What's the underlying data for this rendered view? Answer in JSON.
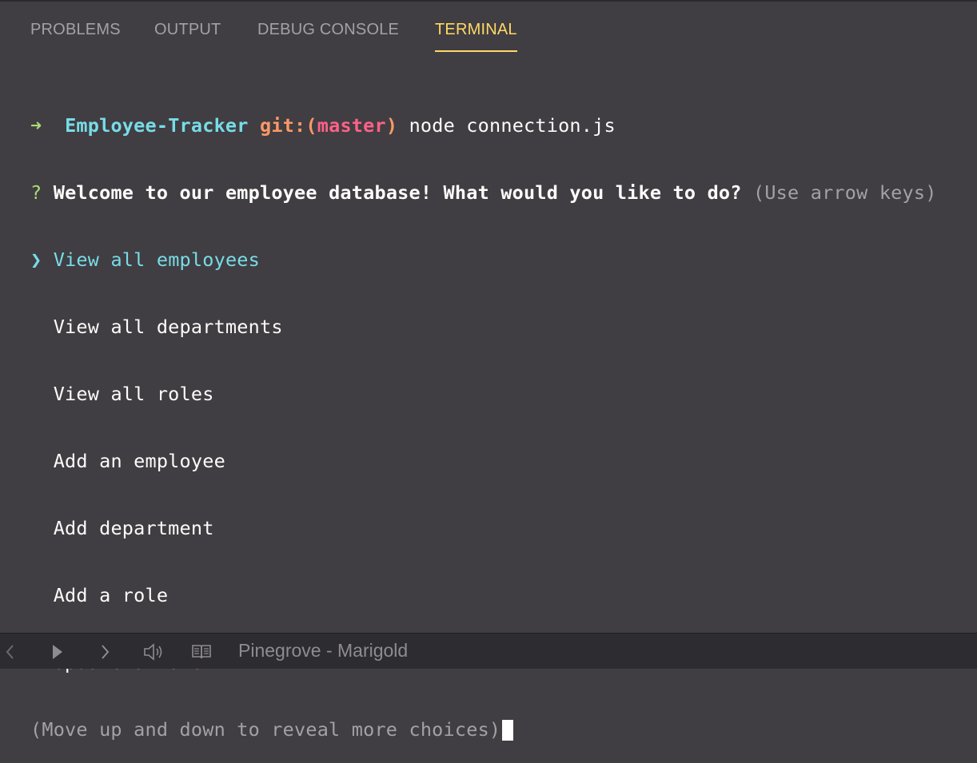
{
  "tabs": [
    {
      "label": "PROBLEMS",
      "active": false
    },
    {
      "label": "OUTPUT",
      "active": false
    },
    {
      "label": "DEBUG CONSOLE",
      "active": false
    },
    {
      "label": "TERMINAL",
      "active": true
    }
  ],
  "terminal": {
    "prompt": {
      "arrow": "➜",
      "directory": "Employee-Tracker",
      "git_prefix": "git:(",
      "branch": "master",
      "git_suffix": ")",
      "command": "node connection.js"
    },
    "question": {
      "mark": "?",
      "text": "Welcome to our employee database! What would you like to do?",
      "hint": "(Use arrow keys)"
    },
    "pointer": "❯",
    "choices": [
      {
        "label": "View all employees",
        "selected": true
      },
      {
        "label": "View all departments",
        "selected": false
      },
      {
        "label": "View all roles",
        "selected": false
      },
      {
        "label": "Add an employee",
        "selected": false
      },
      {
        "label": "Add department",
        "selected": false
      },
      {
        "label": "Add a role",
        "selected": false
      },
      {
        "label": "Update a role",
        "selected": false
      }
    ],
    "more_hint": "(Move up and down to reveal more choices)"
  },
  "statusbar": {
    "icons": [
      "chevron-left-icon",
      "play-icon",
      "chevron-right-icon",
      "speaker-icon",
      "book-icon"
    ],
    "now_playing": "Pinegrove - Marigold"
  },
  "colors": {
    "background": "#403e42",
    "active_tab": "#ffd866",
    "accent_cyan": "#78dce8",
    "accent_green": "#a9dc76",
    "accent_orange": "#fc9867",
    "accent_pink": "#ff6188"
  }
}
